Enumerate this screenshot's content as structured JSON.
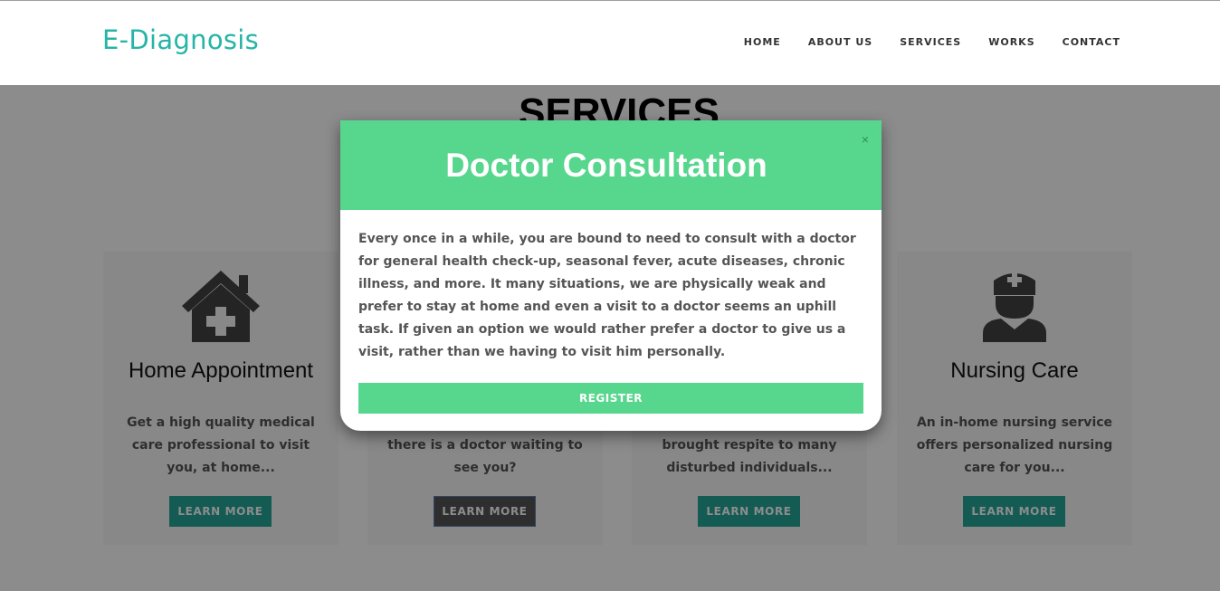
{
  "brand": "E-Diagnosis",
  "nav": {
    "home": "HOME",
    "about": "ABOUT US",
    "services": "SERVICES",
    "works": "WORKS",
    "contact": "CONTACT"
  },
  "section_title": "SERVICES",
  "cards": [
    {
      "title": "Home Appointment",
      "text": "Get a high quality medical care professional to visit you, at home...",
      "button": "LEARN MORE",
      "icon": "home-medical-icon"
    },
    {
      "title": "",
      "text": "there is a doctor waiting to see you?",
      "button": "LEARN MORE",
      "icon": ""
    },
    {
      "title": "",
      "text": "brought respite to many disturbed individuals...",
      "button": "LEARN MORE",
      "icon": ""
    },
    {
      "title": "Nursing Care",
      "text": "An in-home nursing service offers personalized nursing care for you...",
      "button": "LEARN MORE",
      "icon": "nurse-icon"
    }
  ],
  "modal": {
    "title": "Doctor Consultation",
    "close": "×",
    "body": "Every once in a while, you are bound to need to consult with a doctor for general health check-up, seasonal fever, acute diseases, chronic illness, and more. It many situations, we are physically weak and prefer to stay at home and even a visit to a doctor seems an uphill task. If given an option we would rather prefer a doctor to give us a visit, rather than we having to visit him personally.",
    "button": "REGISTER"
  },
  "colors": {
    "brand": "#26b5a6",
    "accent_green": "#57d68d",
    "teal_button": "#26a69a"
  }
}
